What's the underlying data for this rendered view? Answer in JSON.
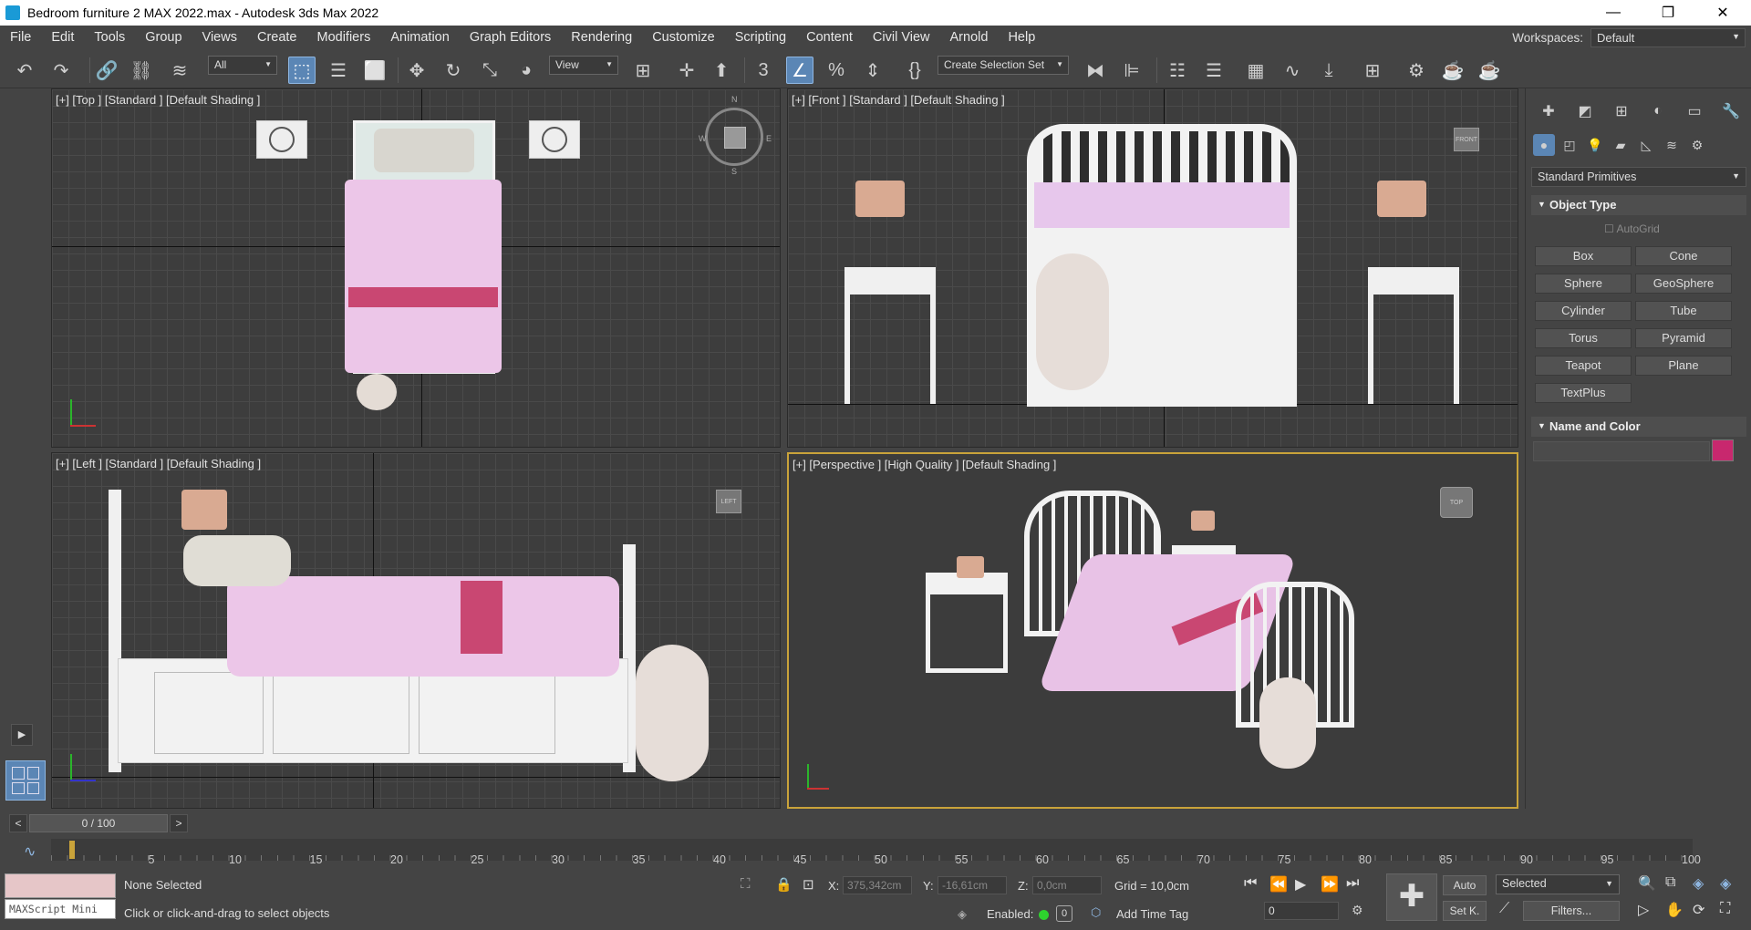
{
  "window": {
    "title": "Bedroom furniture 2 MAX 2022.max - Autodesk 3ds Max 2022",
    "minimize": "—",
    "restore": "❐",
    "close": "✕"
  },
  "menu": {
    "items": [
      "File",
      "Edit",
      "Tools",
      "Group",
      "Views",
      "Create",
      "Modifiers",
      "Animation",
      "Graph Editors",
      "Rendering",
      "Customize",
      "Scripting",
      "Content",
      "Civil View",
      "Arnold",
      "Help"
    ],
    "workspaces_label": "Workspaces:",
    "workspaces_value": "Default"
  },
  "toolbar": {
    "filter_value": "All",
    "refcoord_value": "View",
    "selection_set_value": "Create Selection Set",
    "snap_3": "3"
  },
  "viewports": {
    "top": {
      "label": "[+] [Top ] [Standard ] [Default Shading ]"
    },
    "front": {
      "label": "[+] [Front ] [Standard ] [Default Shading ]"
    },
    "left": {
      "label": "[+] [Left ] [Standard ] [Default Shading ]"
    },
    "perspective": {
      "label": "[+] [Perspective ] [High Quality ] [Default Shading ]"
    },
    "compass_n": "N",
    "compass_s": "S",
    "compass_w": "W",
    "compass_e": "E"
  },
  "command_panel": {
    "category": "Standard Primitives",
    "object_type_title": "Object Type",
    "autogrid": "AutoGrid",
    "buttons": [
      "Box",
      "Cone",
      "Sphere",
      "GeoSphere",
      "Cylinder",
      "Tube",
      "Torus",
      "Pyramid",
      "Teapot",
      "Plane",
      "TextPlus"
    ],
    "name_color_title": "Name and Color",
    "object_color": "#c8286e"
  },
  "timeline": {
    "frame_display": "0 / 100",
    "ticks": [
      "5",
      "10",
      "15",
      "20",
      "25",
      "30",
      "35",
      "40",
      "45",
      "50",
      "55",
      "60",
      "65",
      "70",
      "75",
      "80",
      "85",
      "90",
      "95",
      "100"
    ],
    "prev": "<",
    "next": ">"
  },
  "status": {
    "maxscript": "MAXScript Mini",
    "selection": "None Selected",
    "prompt": "Click or click-and-drag to select objects",
    "x_label": "X:",
    "x_value": "375,342cm",
    "y_label": "Y:",
    "y_value": "-16,61cm",
    "z_label": "Z:",
    "z_value": "0,0cm",
    "grid": "Grid = 10,0cm",
    "enabled_label": "Enabled:",
    "add_time_tag": "Add Time Tag",
    "auto": "Auto",
    "set_key": "Set K.",
    "key_filter_value": "Selected",
    "frame_value": "0",
    "filters": "Filters..."
  },
  "colors": {
    "accent": "#5b86b5",
    "active_viewport_border": "#c9a33a"
  }
}
